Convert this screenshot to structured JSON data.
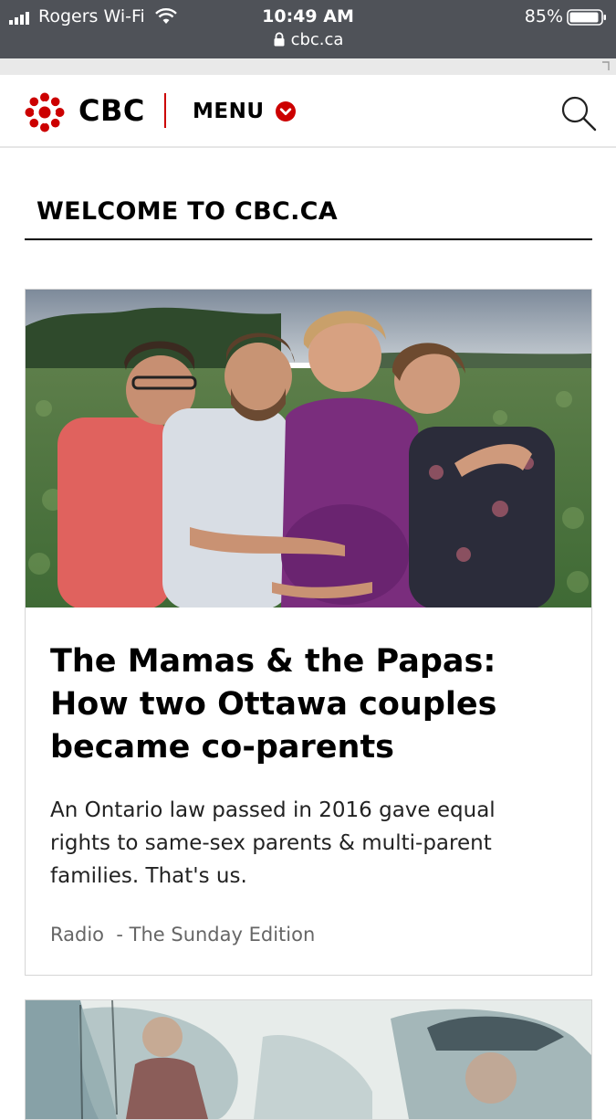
{
  "status_bar": {
    "carrier": "Rogers Wi-Fi",
    "time": "10:49 AM",
    "battery": "85%",
    "url": "cbc.ca"
  },
  "header": {
    "brand": "CBC",
    "menu_label": "MENU"
  },
  "page": {
    "section_title": "WELCOME TO CBC.CA"
  },
  "story": {
    "headline": "The Mamas & the Papas: How two Ottawa couples became co-parents",
    "deck": "An Ontario law passed in 2016 gave equal rights to same-sex parents & multi-parent families. That's us.",
    "category": "Radio",
    "separator": "  - ",
    "show": "The Sunday Edition"
  },
  "icons": {
    "gem": "cbc-gem-icon",
    "menu": "chevron-down-circle-icon",
    "search": "search-icon"
  },
  "colors": {
    "brand_red": "#cc0000",
    "status_bar": "#4f5258"
  }
}
